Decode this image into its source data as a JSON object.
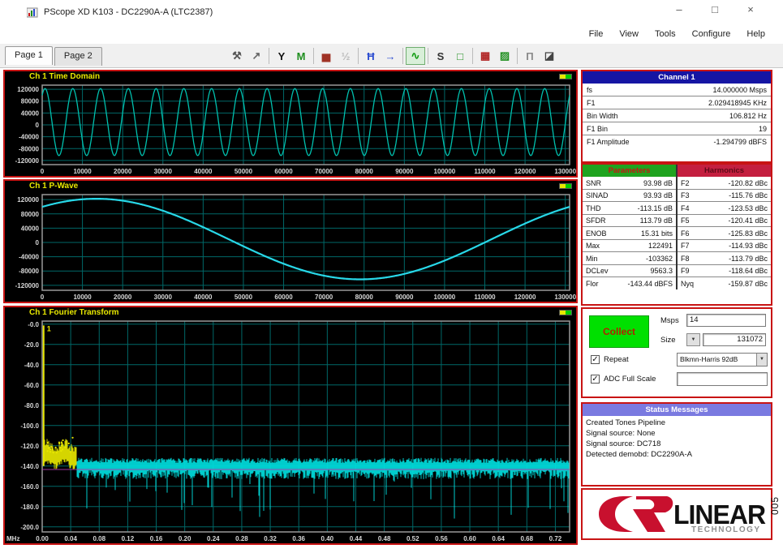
{
  "window": {
    "title": "PScope XD K103 - DC2290A-A (LTC2387)",
    "controls": {
      "minimize": "–",
      "maximize": "□",
      "close": "×"
    }
  },
  "menu": {
    "items": [
      "File",
      "View",
      "Tools",
      "Configure",
      "Help"
    ]
  },
  "tabs": [
    {
      "label": "Page 1",
      "active": true
    },
    {
      "label": "Page 2",
      "active": false
    }
  ],
  "toolbar": {
    "groups": [
      [
        {
          "name": "pickaxe-tool-icon",
          "glyph": "⚒",
          "color": "#555555"
        },
        {
          "name": "zoom-arrow-icon",
          "glyph": "↗",
          "color": "#666666"
        }
      ],
      [
        {
          "name": "filter-y-icon",
          "glyph": "Y",
          "color": "#111111"
        },
        {
          "name": "histogram-icon",
          "glyph": "M",
          "color": "#1f8f1f"
        }
      ],
      [
        {
          "name": "bar-chart-icon",
          "glyph": "▅",
          "color": "#a03326"
        },
        {
          "name": "half-scale-icon",
          "glyph": "½",
          "color": "#bbbbbb",
          "disabled": true
        }
      ],
      [
        {
          "name": "time-markers-icon",
          "glyph": "Ħ",
          "color": "#2a4bd0"
        },
        {
          "name": "advance-arrow-icon",
          "glyph": "→",
          "color": "#2a4bd0"
        }
      ],
      [
        {
          "name": "signal-chain-icon",
          "glyph": "∿",
          "color": "#0d9a0d",
          "selected": true
        }
      ],
      [
        {
          "name": "s-curve-icon",
          "glyph": "S",
          "color": "#333333"
        },
        {
          "name": "outline-box-icon",
          "glyph": "□",
          "color": "#1f8f1f"
        }
      ],
      [
        {
          "name": "board-red-icon",
          "glyph": "▦",
          "color": "#b02222"
        },
        {
          "name": "board-green-icon",
          "glyph": "▨",
          "color": "#1f8f1f"
        }
      ],
      [
        {
          "name": "square-wave-icon",
          "glyph": "Π",
          "color": "#8a8a8a"
        },
        {
          "name": "export-image-icon",
          "glyph": "◪",
          "color": "#444444"
        }
      ]
    ]
  },
  "channel_panel": {
    "header": "Channel 1",
    "rows": [
      {
        "label": "fs",
        "value": "14.000000 Msps"
      },
      {
        "label": "F1",
        "value": "2.029418945 KHz"
      },
      {
        "label": "Bin Width",
        "value": "106.812 Hz"
      },
      {
        "label": "F1 Bin",
        "value": "19"
      },
      {
        "label": "F1 Amplitude",
        "value": "-1.294799 dBFS"
      }
    ]
  },
  "parameters": {
    "header": "Parameters",
    "rows": [
      {
        "label": "SNR",
        "value": "93.98 dB"
      },
      {
        "label": "SINAD",
        "value": "93.93 dB"
      },
      {
        "label": "THD",
        "value": "-113.15 dB"
      },
      {
        "label": "SFDR",
        "value": "113.79 dB"
      },
      {
        "label": "ENOB",
        "value": "15.31 bits"
      },
      {
        "label": "Max",
        "value": "122491"
      },
      {
        "label": "Min",
        "value": "-103362"
      },
      {
        "label": "DCLev",
        "value": "9563.3"
      },
      {
        "label": "Flor",
        "value": "-143.44 dBFS"
      }
    ]
  },
  "harmonics": {
    "header": "Harmonics",
    "rows": [
      {
        "label": "F2",
        "value": "-120.82 dBc"
      },
      {
        "label": "F3",
        "value": "-115.76 dBc"
      },
      {
        "label": "F4",
        "value": "-123.53 dBc"
      },
      {
        "label": "F5",
        "value": "-120.41 dBc"
      },
      {
        "label": "F6",
        "value": "-125.83 dBc"
      },
      {
        "label": "F7",
        "value": "-114.93 dBc"
      },
      {
        "label": "F8",
        "value": "-113.79 dBc"
      },
      {
        "label": "F9",
        "value": "-118.64 dBc"
      },
      {
        "label": "Nyq",
        "value": "-159.87 dBc"
      }
    ]
  },
  "collect": {
    "button_label": "Collect",
    "msps_label": "Msps",
    "msps_value": "14",
    "size_label": "Size",
    "size_value": "131072",
    "repeat_label": "Repeat",
    "repeat_checked": true,
    "window_value": "Blkmn-Harris 92dB",
    "adc_label": "ADC Full Scale",
    "adc_value": "",
    "adc_checked": true,
    "check_glyph": "✓"
  },
  "status": {
    "header": "Status Messages",
    "lines": [
      "Created Tones Pipeline",
      "Signal source: None",
      "Signal source: DC718",
      "Detected demobd: DC2290A-A"
    ]
  },
  "logo": {
    "brand": "LINEAR",
    "sub": "TECHNOLOGY"
  },
  "figure_number": "005",
  "colors": {
    "accent_red": "#c81414",
    "grid_teal": "#006868",
    "axis_text": "#d8d8d8",
    "chart_title_yellow": "#e8e800"
  },
  "chart_data": [
    {
      "id": "time",
      "type": "line",
      "title": "Ch 1 Time Domain",
      "xlim": [
        0,
        131072
      ],
      "x_ticks": [
        0,
        10000,
        20000,
        30000,
        40000,
        50000,
        60000,
        70000,
        80000,
        90000,
        100000,
        110000,
        120000,
        130000
      ],
      "x_tick_labels": [
        "0",
        "10000",
        "20000",
        "30000",
        "40000",
        "50000",
        "60000",
        "70000",
        "80000",
        "90000",
        "100000",
        "110000",
        "120000",
        "130000"
      ],
      "ylim": [
        -134000,
        134000
      ],
      "y_ticks": [
        120000,
        80000,
        40000,
        0,
        -40000,
        -80000,
        -120000
      ],
      "y_tick_labels": [
        "120000",
        "80000",
        "40000",
        "0",
        "-40000",
        "-80000",
        "-120000"
      ],
      "signal": {
        "kind": "sine",
        "cycles": 19,
        "amplitude": 112900,
        "dc": 9563,
        "phase_deg": 53
      },
      "line_color": "#00c0ae",
      "line_width": 1.3
    },
    {
      "id": "pwave",
      "type": "line",
      "title": "Ch 1 P-Wave",
      "xlim": [
        0,
        131072
      ],
      "x_ticks": [
        0,
        10000,
        20000,
        30000,
        40000,
        50000,
        60000,
        70000,
        80000,
        90000,
        100000,
        110000,
        120000,
        130000
      ],
      "x_tick_labels": [
        "0",
        "10000",
        "20000",
        "30000",
        "40000",
        "50000",
        "60000",
        "70000",
        "80000",
        "90000",
        "100000",
        "110000",
        "120000",
        "130000"
      ],
      "ylim": [
        -134000,
        134000
      ],
      "y_ticks": [
        120000,
        80000,
        40000,
        0,
        -40000,
        -80000,
        -120000
      ],
      "y_tick_labels": [
        "120000",
        "80000",
        "40000",
        "0",
        "-40000",
        "-80000",
        "-120000"
      ],
      "signal": {
        "kind": "sine",
        "cycles": 1,
        "amplitude": 112900,
        "dc": 9563,
        "phase_deg": 53
      },
      "line_color": "#28d8e8",
      "line_width": 2.2
    },
    {
      "id": "fft",
      "type": "line",
      "title": "Ch 1 Fourier Transform",
      "x_prefix": "MHz",
      "xlim": [
        0,
        0.74
      ],
      "x_ticks": [
        0,
        0.04,
        0.08,
        0.12,
        0.16,
        0.2,
        0.24,
        0.28,
        0.32,
        0.36,
        0.4,
        0.44,
        0.48,
        0.52,
        0.56,
        0.6,
        0.64,
        0.68,
        0.72
      ],
      "x_tick_labels": [
        "0.00",
        "0.04",
        "0.08",
        "0.12",
        "0.16",
        "0.20",
        "0.24",
        "0.28",
        "0.32",
        "0.36",
        "0.40",
        "0.44",
        "0.48",
        "0.52",
        "0.56",
        "0.60",
        "0.64",
        "0.68",
        "0.72"
      ],
      "ylim": [
        -205,
        3
      ],
      "y_ticks": [
        0,
        -20,
        -40,
        -60,
        -80,
        -100,
        -120,
        -140,
        -160,
        -180,
        -200
      ],
      "y_tick_labels": [
        "-0.0",
        "-20.0",
        "-40.0",
        "-60.0",
        "-80.0",
        "-100.0",
        "-120.0",
        "-140.0",
        "-160.0",
        "-180.0",
        "-200.0"
      ],
      "fundamental": {
        "freq_mhz": 0.002,
        "amplitude_db": -1.29,
        "marker": "1",
        "color": "#e8e800"
      },
      "noise_floor_db": -143.44,
      "floor_line_color": "#b03ab0",
      "noise": {
        "left_region_end_mhz": 0.048,
        "left_color": "#e8e800",
        "left_level_db": -132,
        "main_color": "#00dede",
        "main_level_db": -141
      }
    }
  ]
}
